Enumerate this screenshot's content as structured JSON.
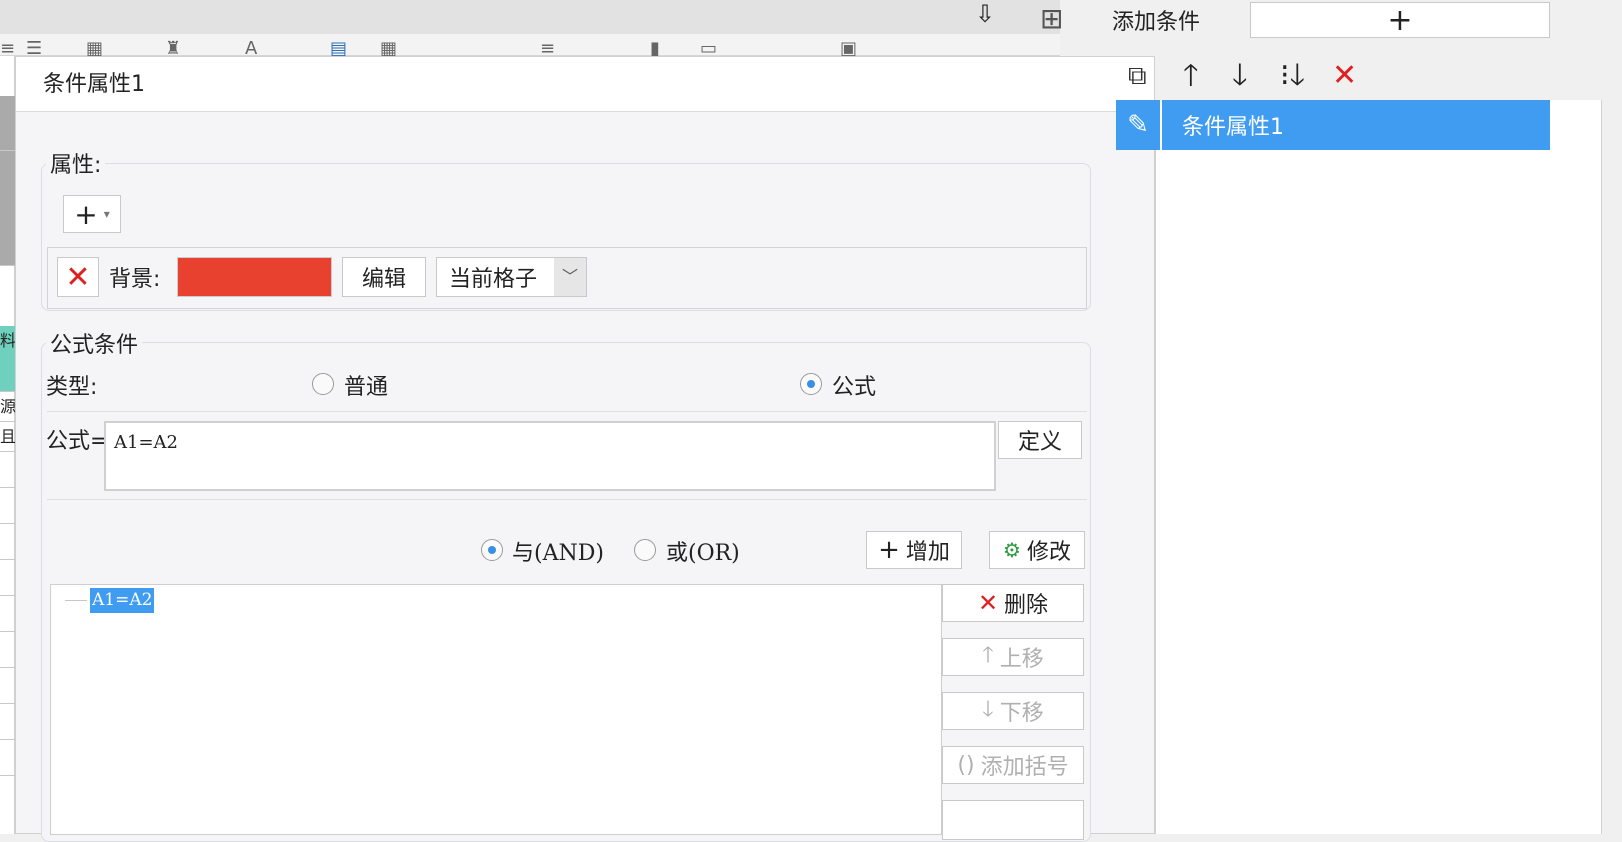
{
  "background": {
    "left_cells": [
      "料",
      "源",
      "且"
    ]
  },
  "dialog": {
    "title": "条件属性1",
    "properties": {
      "group_title": "属性:",
      "add_button": "+",
      "row": {
        "label": "背景:",
        "color": "#e8412f",
        "edit_button": "编辑",
        "scope_select": "当前格子"
      }
    },
    "formula_condition": {
      "group_title": "公式条件",
      "type_label": "类型:",
      "type_options": [
        "普通",
        "公式"
      ],
      "type_selected": "公式",
      "formula_label": "公式=",
      "formula_value": "A1=A2",
      "define_button": "定义",
      "logic_options": [
        "与(AND)",
        "或(OR)"
      ],
      "logic_selected": "与(AND)",
      "add_button": "增加",
      "modify_button": "修改",
      "conditions": [
        "A1=A2"
      ],
      "side_buttons": {
        "delete": "删除",
        "move_up": "上移",
        "move_down": "下移",
        "add_bracket": "添加括号"
      }
    }
  },
  "right_panel": {
    "add_condition_label": "添加条件",
    "add_button": "+",
    "items": [
      {
        "label": "条件属性1",
        "selected": true
      }
    ],
    "accent": "#3f9cf0"
  }
}
